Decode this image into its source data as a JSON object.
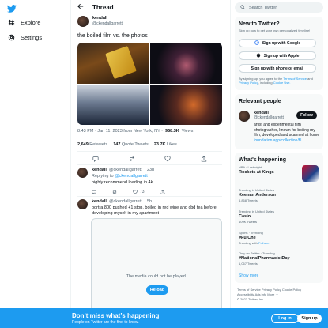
{
  "nav": {
    "logo_icon": "bird-icon",
    "items": [
      {
        "label": "Explore",
        "icon": "hash-icon"
      },
      {
        "label": "Settings",
        "icon": "gear-icon"
      }
    ]
  },
  "thread": {
    "title": "Thread",
    "author_name": "kendall",
    "author_handle": "@ckendallgarrett",
    "text": "the boiled film vs. the photos",
    "timestamp": "8:43 PM · Jan 11, 2023 from New York, NY ·",
    "views_count": "958.3K",
    "views_label": "Views",
    "stats": {
      "retweets_count": "2,649",
      "retweets_label": "Retweets",
      "quotes_count": "147",
      "quotes_label": "Quote Tweets",
      "likes_count": "23.7K",
      "likes_label": "Likes"
    }
  },
  "replies": [
    {
      "name": "kendall",
      "handle": "@ckendallgarrett",
      "time": "· 23h",
      "replying_prefix": "Replying to",
      "replying_to": "@ckendallgarrett",
      "text": "highly recommend loading in 4k",
      "views": "17.9K",
      "likes": "73"
    },
    {
      "name": "kendall",
      "handle": "@ckendallgarrett",
      "time": "· 5h",
      "text": "portra 800 pushed +1 stop, boiled in red wine and cbd tea before developing myself in my apartment"
    }
  ],
  "video": {
    "message": "The media could not be played.",
    "reload_label": "Reload"
  },
  "right": {
    "search_placeholder": "Search Twitter",
    "new": {
      "title": "New to Twitter?",
      "subtitle": "Sign up now to get your own personalized timeline!",
      "google_label": "Sign up with Google",
      "apple_label": "Sign up with Apple",
      "phone_label": "Sign up with phone or email",
      "terms_prefix": "By signing up, you agree to the",
      "terms_link": "Terms of Service",
      "terms_and": "and",
      "privacy_link": "Privacy Policy",
      "terms_including": ", including",
      "cookie_link": "Cookie Use."
    },
    "relevant": {
      "title": "Relevant people",
      "name": "kendall",
      "handle": "@ckendallgarrett",
      "follow_label": "Follow",
      "bio": "artist and experimental film photographer, known for boiling my film; developed and scanned at home",
      "bio_link": "foundation.app/collection/fil..."
    },
    "happening": {
      "title": "What's happening",
      "trends": [
        {
          "context": "NBA · Last night",
          "name": "Rockets at Kings",
          "count": ""
        },
        {
          "context": "Trending in United States",
          "name": "Keenan Anderson",
          "count": "6,868 Tweets"
        },
        {
          "context": "Trending in United States",
          "name": "Casio",
          "count": "109K Tweets"
        },
        {
          "context": "Sports · Trending",
          "name": "#FulChe",
          "count_prefix": "Trending with",
          "count_link": "Fulham"
        },
        {
          "context": "Only on Twitter · Trending",
          "name": "#NationalPharmacistDay",
          "count": "1,067 Tweets"
        }
      ],
      "show_more": "Show more"
    },
    "footer": {
      "line1": "Terms of Service   Privacy Policy   Cookie Policy",
      "line2": "Accessibility   Ads info   More ···",
      "line3": "© 2023 Twitter, Inc."
    }
  },
  "banner": {
    "title": "Don’t miss what’s happening",
    "subtitle": "People on Twitter are the first to know.",
    "login_label": "Log in",
    "signup_label": "Sign up"
  },
  "colors": {
    "accent": "#1d9bf0",
    "text": "#0f1419",
    "muted": "#536471"
  }
}
